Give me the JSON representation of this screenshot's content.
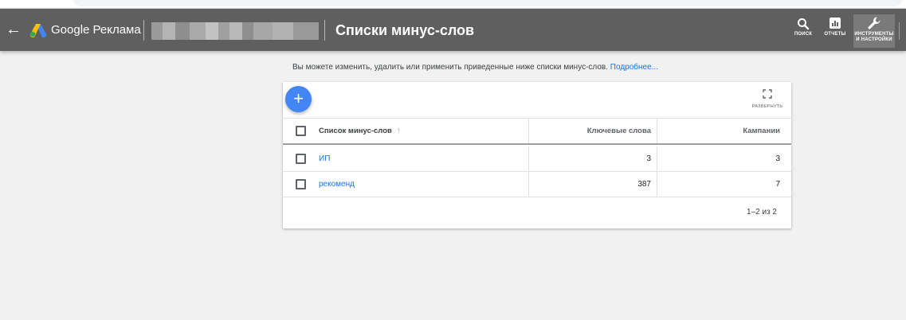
{
  "topbar": {
    "brand": "Google Реклама",
    "page_title": "Списки минус-слов",
    "tools": [
      {
        "icon": "search-icon",
        "label": "ПОИСК"
      },
      {
        "icon": "reports-icon",
        "label": "ОТЧЕТЫ"
      },
      {
        "icon": "wrench-icon",
        "label_line1": "ИНСТРУМЕНТЫ",
        "label_line2": "И НАСТРОЙКИ"
      }
    ]
  },
  "hint": {
    "text": "Вы можете изменить, удалить или применить приведенные ниже списки минус-слов.",
    "link": "Подробнее..."
  },
  "card": {
    "expand_label": "РАЗВЕРНУТЬ",
    "columns": {
      "name": "Список минус-слов",
      "keywords": "Ключевые слова",
      "campaigns": "Кампании"
    },
    "rows": [
      {
        "name": "ИП",
        "keywords": "3",
        "campaigns": "3"
      },
      {
        "name": "рекоменд",
        "keywords": "387",
        "campaigns": "7"
      }
    ],
    "pagination": "1–2 из 2"
  },
  "colors": {
    "topbar": "#5f5f5f",
    "accent": "#1a73e8",
    "fab": "#4285f4"
  }
}
